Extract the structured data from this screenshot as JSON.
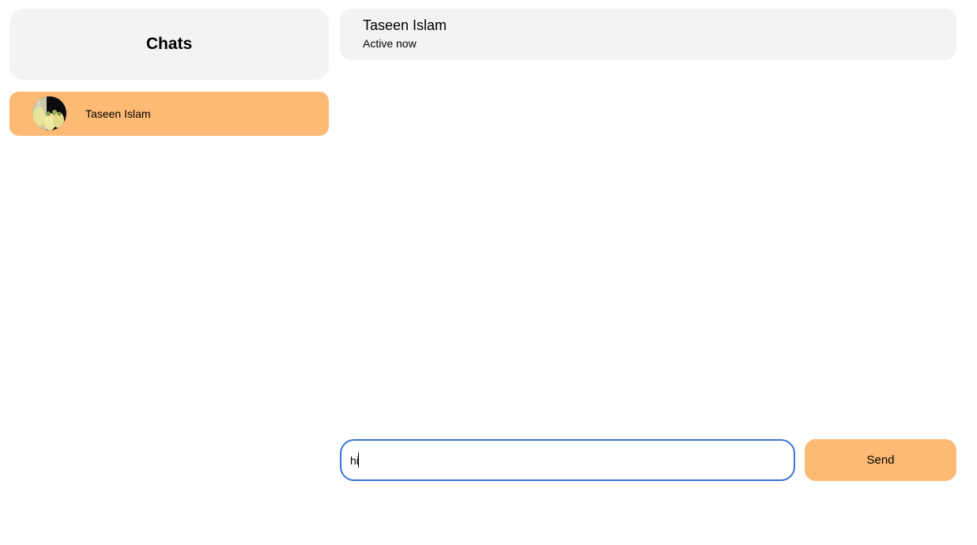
{
  "sidebar": {
    "title": "Chats",
    "chats": [
      {
        "name": "Taseen Islam",
        "selected": true
      }
    ]
  },
  "conversation": {
    "contact_name": "Taseen Islam",
    "status": "Active now"
  },
  "composer": {
    "input_value": "hi",
    "send_label": "Send"
  },
  "colors": {
    "accent": "#fdba74",
    "panel": "#f2f3f5",
    "focus_border": "#3b73d9"
  }
}
